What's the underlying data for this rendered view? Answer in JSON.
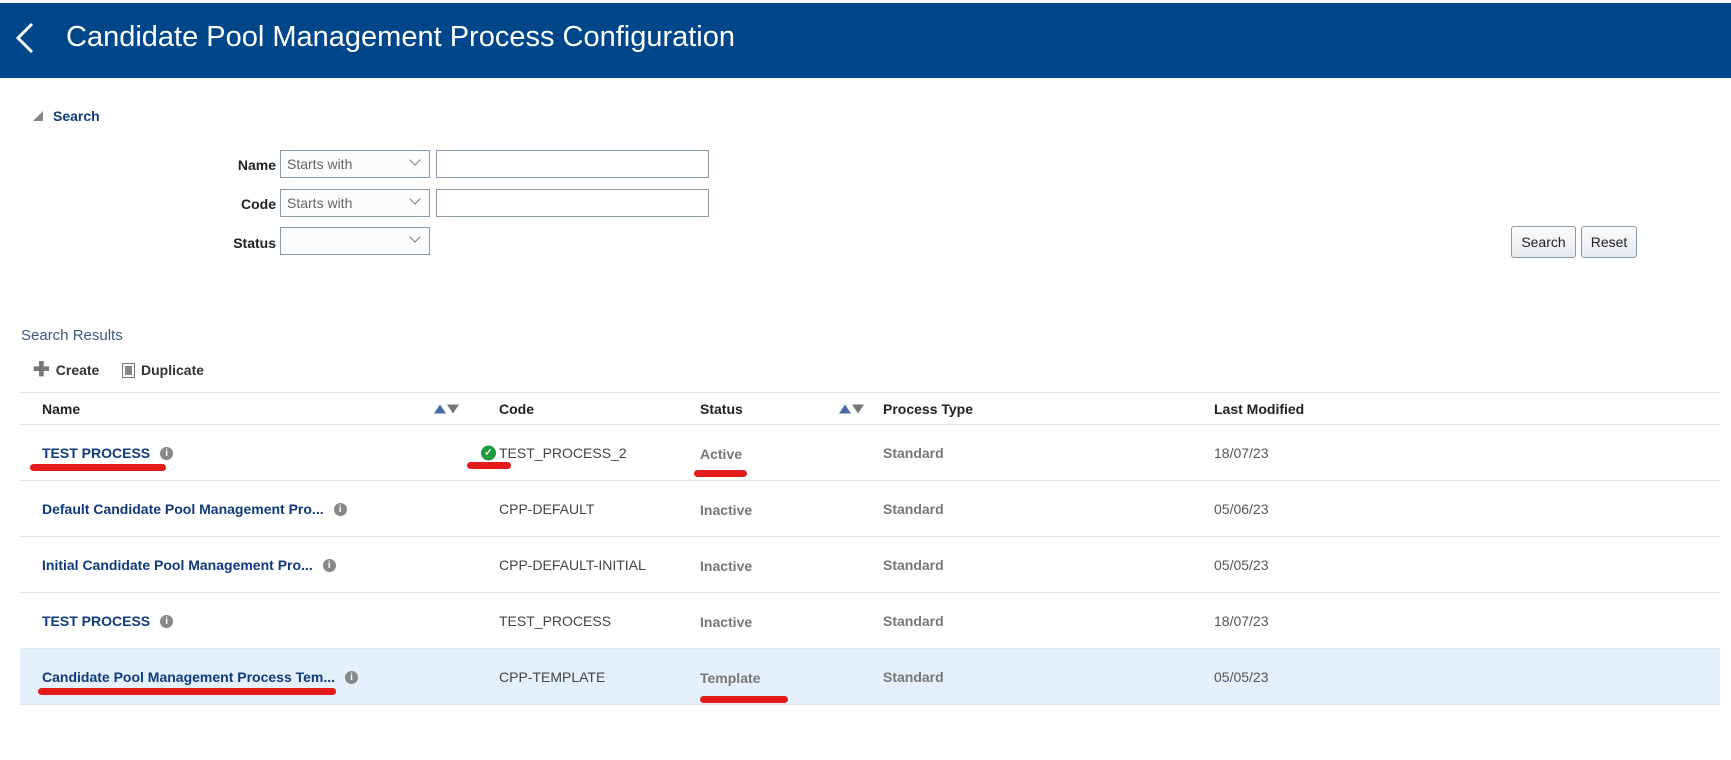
{
  "header": {
    "title": "Candidate Pool Management Process Configuration",
    "bg_color": "#00468b"
  },
  "search": {
    "toggle_label": "Search",
    "name_label": "Name",
    "name_operator": "Starts with",
    "name_value": "",
    "code_label": "Code",
    "code_operator": "Starts with",
    "code_value": "",
    "status_label": "Status",
    "status_value": "",
    "search_button": "Search",
    "reset_button": "Reset"
  },
  "results": {
    "title": "Search Results",
    "create_label": "Create",
    "duplicate_label": "Duplicate",
    "columns": [
      "Name",
      "Code",
      "Status",
      "Process Type",
      "Last Modified"
    ],
    "rows": [
      {
        "name": "TEST PROCESS",
        "code": "TEST_PROCESS_2",
        "status": "Active",
        "process_type": "Standard",
        "last_modified": "18/07/23"
      },
      {
        "name": "Default Candidate Pool Management Pro...",
        "code": "CPP-DEFAULT",
        "status": "Inactive",
        "process_type": "Standard",
        "last_modified": "05/06/23"
      },
      {
        "name": "Initial Candidate Pool Management Pro...",
        "code": "CPP-DEFAULT-INITIAL",
        "status": "Inactive",
        "process_type": "Standard",
        "last_modified": "05/05/23"
      },
      {
        "name": "TEST PROCESS",
        "code": "TEST_PROCESS",
        "status": "Inactive",
        "process_type": "Standard",
        "last_modified": "18/07/23"
      },
      {
        "name": "Candidate Pool Management Process Tem...",
        "code": "CPP-TEMPLATE",
        "status": "Template",
        "process_type": "Standard",
        "last_modified": "05/05/23"
      }
    ]
  }
}
